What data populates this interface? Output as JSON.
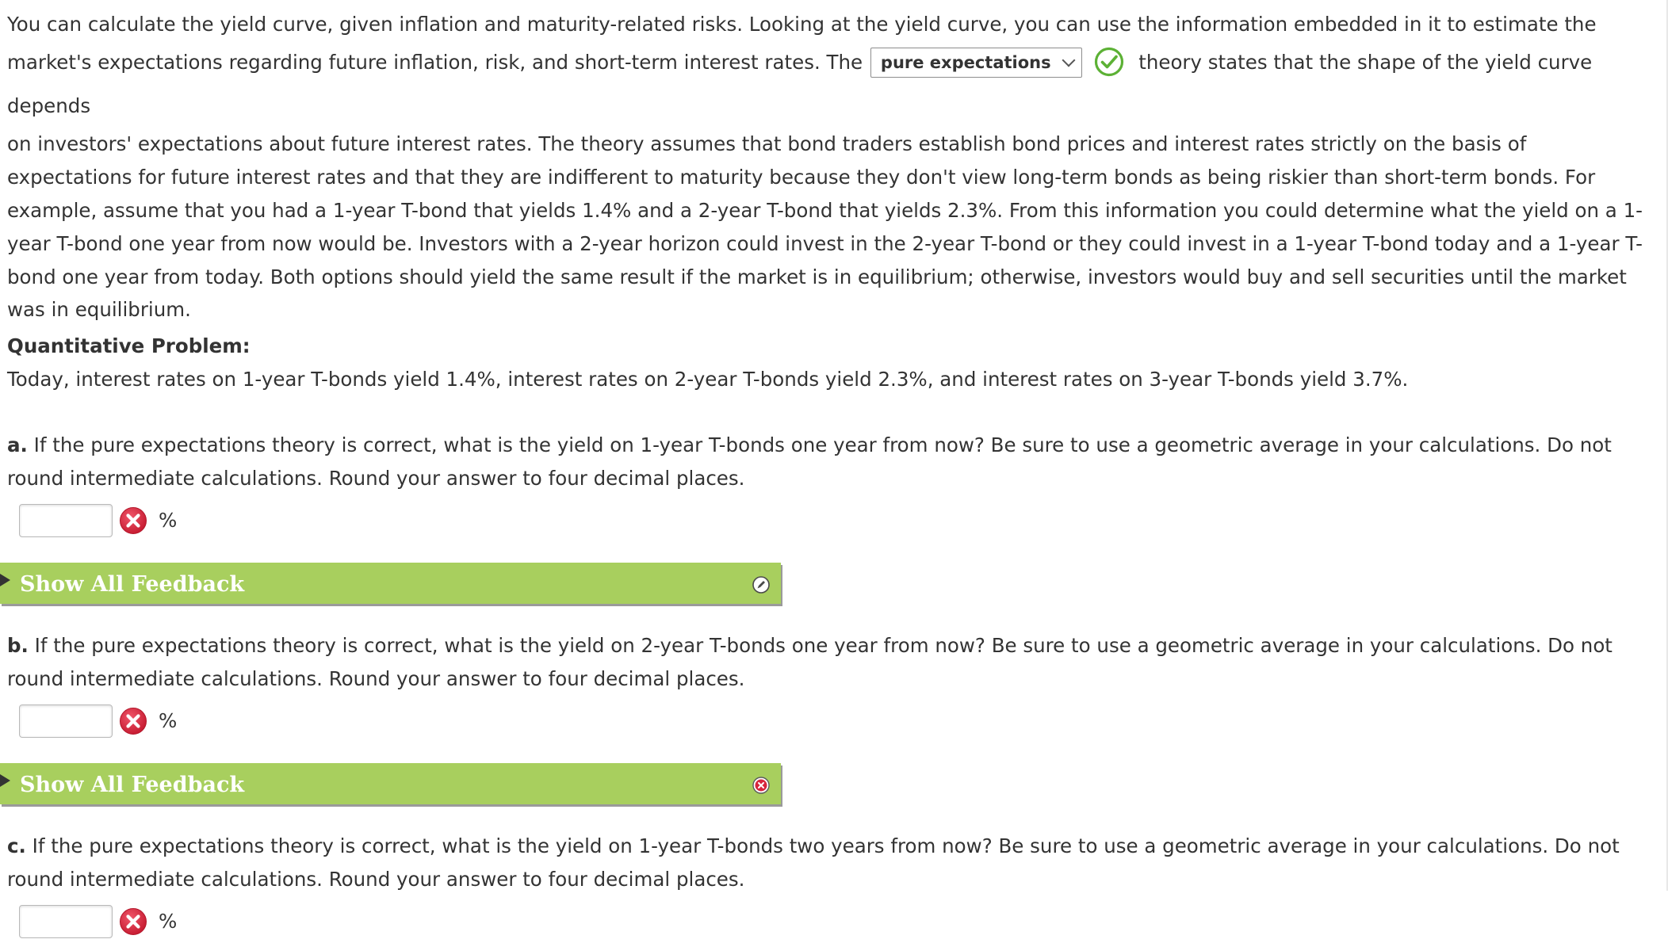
{
  "intro": {
    "line1": "You can calculate the yield curve, given inflation and maturity-related risks. Looking at the yield curve, you can use the information embedded in it to estimate the",
    "line2_before": "market's expectations regarding future inflation, risk, and short-term interest rates. The",
    "dropdown_value": "pure expectations",
    "line2_after": "theory states that the shape of the yield curve depends",
    "rest": "on investors' expectations about future interest rates. The theory assumes that bond traders establish bond prices and interest rates strictly on the basis of expectations for future interest rates and that they are indifferent to maturity because they don't view long-term bonds as being riskier than short-term bonds. For example, assume that you had a 1-year T-bond that yields 1.4% and a 2-year T-bond that yields 2.3%. From this information you could determine what the yield on a 1-year T-bond one year from now would be. Investors with a 2-year horizon could invest in the 2-year T-bond or they could invest in a 1-year T-bond today and a 1-year T-bond one year from today. Both options should yield the same result if the market is in equilibrium; otherwise, investors would buy and sell securities until the market was in equilibrium."
  },
  "problem": {
    "heading": "Quantitative Problem:",
    "statement": "Today, interest rates on 1-year T-bonds yield 1.4%, interest rates on 2-year T-bonds yield 2.3%, and interest rates on 3-year T-bonds yield 3.7%."
  },
  "questions": [
    {
      "label": "a.",
      "text": "If the pure expectations theory is correct, what is the yield on 1-year T-bonds one year from now? Be sure to use a geometric average in your calculations. Do not round intermediate calculations. Round your answer to four decimal places.",
      "answer_value": "",
      "unit": "%",
      "feedback_label": "Show All Feedback",
      "feedback_icon": "pencil-icon"
    },
    {
      "label": "b.",
      "text": "If the pure expectations theory is correct, what is the yield on 2-year T-bonds one year from now? Be sure to use a geometric average in your calculations. Do not round intermediate calculations. Round your answer to four decimal places.",
      "answer_value": "",
      "unit": "%",
      "feedback_label": "Show All Feedback",
      "feedback_icon": "close-circle-icon"
    },
    {
      "label": "c.",
      "text": "If the pure expectations theory is correct, what is the yield on 1-year T-bonds two years from now? Be sure to use a geometric average in your calculations. Do not round intermediate calculations. Round your answer to four decimal places.",
      "answer_value": "",
      "unit": "%"
    }
  ],
  "colors": {
    "feedback_bar": "#a8cf5e",
    "correct_green": "#5cb135",
    "incorrect_red": "#d7263d",
    "text": "#333333"
  }
}
